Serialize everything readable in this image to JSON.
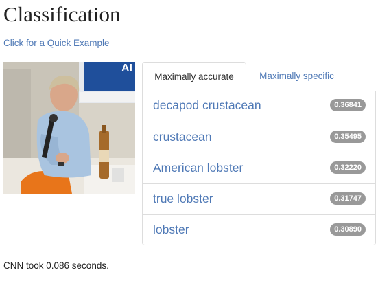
{
  "page": {
    "title": "Classification",
    "example_link": "Click for a Quick Example"
  },
  "image": {
    "subject": "photo of a man with a microphone seated at a conference, beer bottle on table",
    "banner_text": "AI"
  },
  "tabs": [
    {
      "label": "Maximally accurate",
      "active": true
    },
    {
      "label": "Maximally specific",
      "active": false
    }
  ],
  "results": [
    {
      "label": "decapod crustacean",
      "score": "0.36841"
    },
    {
      "label": "crustacean",
      "score": "0.35495"
    },
    {
      "label": "American lobster",
      "score": "0.32220"
    },
    {
      "label": "true lobster",
      "score": "0.31747"
    },
    {
      "label": "lobster",
      "score": "0.30890"
    }
  ],
  "footer": {
    "timing": "CNN took 0.086 seconds."
  },
  "colors": {
    "link": "#4f79b6",
    "badge": "#999999",
    "border": "#dddddd"
  }
}
